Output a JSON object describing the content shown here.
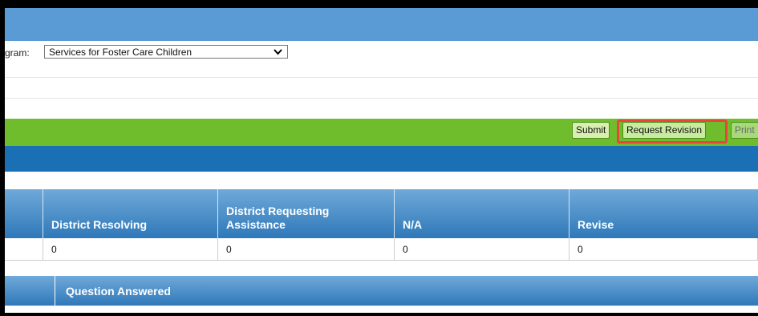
{
  "program": {
    "label": "gram:",
    "selected": "Services for Foster Care Children"
  },
  "toolbar": {
    "submit_label": "Submit",
    "request_revision_label": "Request Revision",
    "print_label": "Print"
  },
  "summary_table": {
    "columns": [
      "District Resolving",
      "District Requesting Assistance",
      "N/A",
      "Revise"
    ],
    "values": [
      "0",
      "0",
      "0",
      "0"
    ]
  },
  "questions_table": {
    "header": "Question Answered"
  },
  "colors": {
    "top_bar": "#5b9bd5",
    "green_bar": "#6fbd2c",
    "blue_bar": "#1a6fb5",
    "highlight": "#e8453c"
  }
}
